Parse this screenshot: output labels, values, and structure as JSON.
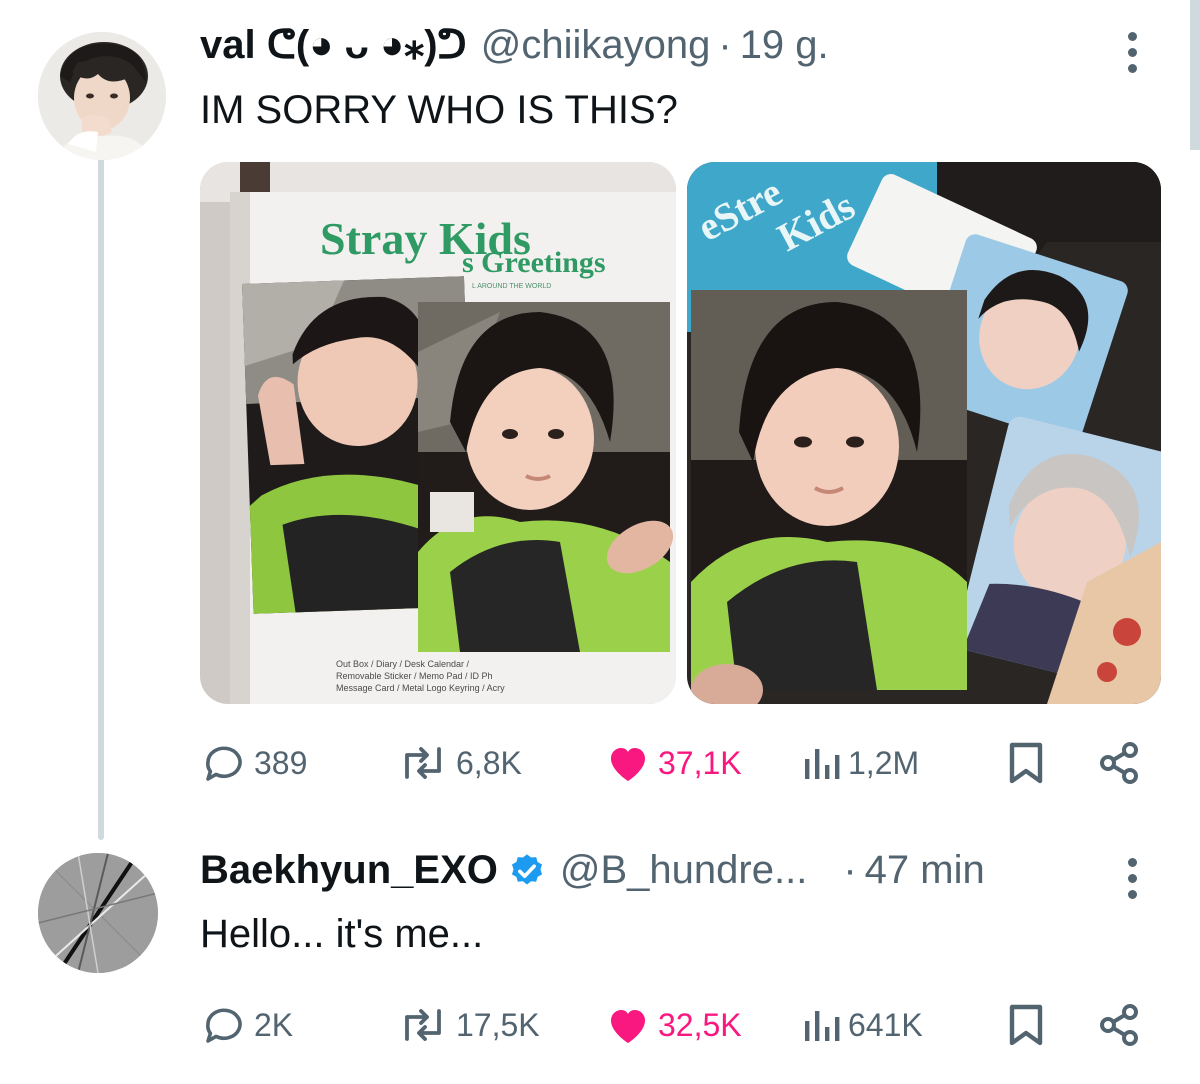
{
  "tweet1": {
    "display_name": "val ᕦ(◕ ᴗ ◕⁎)ᕤ",
    "handle": "@chiikayong",
    "separator": "·",
    "time": "19 g.",
    "text": "IM SORRY WHO IS THIS?",
    "media_left_text": {
      "brand": "Stray Kids",
      "greeting": "s Greetings",
      "tagline": "L AROUND THE WORLD",
      "contents_line1": "Out Box / Diary / Desk Calendar /",
      "contents_line2": "Removable Sticker / Memo Pad / ID Ph",
      "contents_line3": "Message Card / Metal Logo Keyring / Acry"
    },
    "media_right_text": {
      "brand_top": "eStre",
      "brand_bottom": "Kids"
    },
    "stats": {
      "replies": "389",
      "reposts": "6,8K",
      "likes": "37,1K",
      "views": "1,2M"
    }
  },
  "tweet2": {
    "display_name": "Baekhyun_EXO",
    "handle": "@B_hundre...",
    "separator": "·",
    "time": "47 min",
    "text": "Hello... it's me...",
    "stats": {
      "replies": "2K",
      "reposts": "17,5K",
      "likes": "32,5K",
      "views": "641K"
    }
  },
  "icons": {
    "reply": "reply-icon",
    "repost": "repost-icon",
    "like": "heart-icon",
    "views": "views-icon",
    "bookmark": "bookmark-icon",
    "share": "share-icon",
    "verified": "verified-badge-icon",
    "more": "more-options-icon"
  },
  "colors": {
    "text_primary": "#0f1419",
    "text_secondary": "#536471",
    "like_pink": "#f91880",
    "verified_blue": "#1d9bf0",
    "thread_line": "#cfd9de"
  }
}
